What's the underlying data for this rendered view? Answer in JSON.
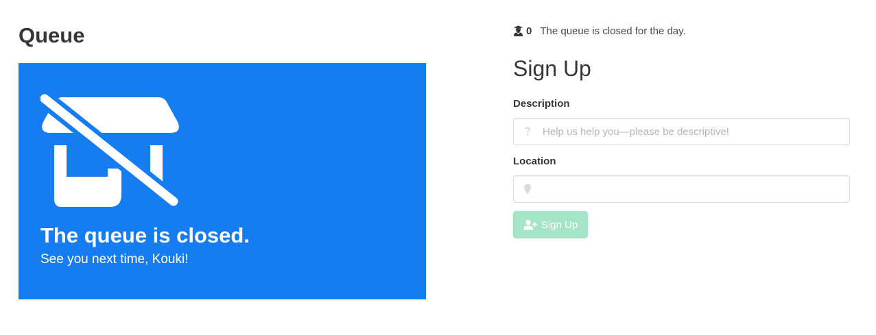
{
  "queue": {
    "title": "Queue",
    "closed_card": {
      "headline": "The queue is closed.",
      "subtext": "See you next time, Kouki!",
      "icon": "store-slash-icon",
      "background_color": "#167df0"
    }
  },
  "status": {
    "icon": "user-graduate-icon",
    "count": "0",
    "message": "The queue is closed for the day."
  },
  "signup": {
    "title": "Sign Up",
    "description": {
      "label": "Description",
      "placeholder": "Help us help you—please be descriptive!",
      "value": "",
      "icon": "question-icon"
    },
    "location": {
      "label": "Location",
      "placeholder": "",
      "value": "",
      "icon": "map-marker-icon"
    },
    "button": {
      "label": "Sign Up",
      "icon": "user-plus-icon",
      "color": "#a6e4c8",
      "disabled": true
    }
  }
}
